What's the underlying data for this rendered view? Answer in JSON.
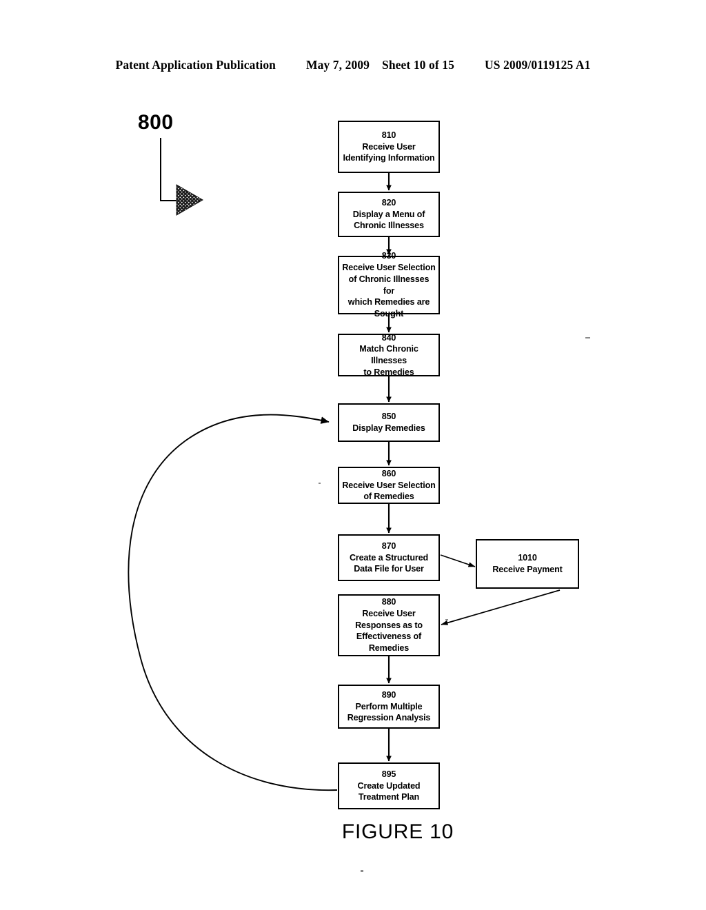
{
  "header": {
    "publication": "Patent Application Publication",
    "date": "May 7, 2009",
    "sheet": "Sheet 10 of 15",
    "patent_number": "US 2009/0119125 A1"
  },
  "figure": {
    "caption": "FIGURE 10",
    "reference_numeral": "800"
  },
  "flowchart": {
    "type": "flowchart",
    "boxes": [
      {
        "id": "810",
        "number": "810",
        "text": "Receive User\nIdentifying Information"
      },
      {
        "id": "820",
        "number": "820",
        "text": "Display a Menu of\nChronic Illnesses"
      },
      {
        "id": "830",
        "number": "830",
        "text": "Receive User Selection\nof Chronic Illnesses for\nwhich Remedies are\nSought"
      },
      {
        "id": "840",
        "number": "840",
        "text": "Match Chronic Illnesses\nto Remedies"
      },
      {
        "id": "850",
        "number": "850",
        "text": "Display Remedies"
      },
      {
        "id": "860",
        "number": "860",
        "text": "Receive User Selection\nof Remedies"
      },
      {
        "id": "870",
        "number": "870",
        "text": "Create a Structured\nData File for User"
      },
      {
        "id": "880",
        "number": "880",
        "text": "Receive User\nResponses as to\nEffectiveness of\nRemedies"
      },
      {
        "id": "890",
        "number": "890",
        "text": "Perform Multiple\nRegression Analysis"
      },
      {
        "id": "895",
        "number": "895",
        "text": "Create Updated\nTreatment Plan"
      },
      {
        "id": "1010",
        "number": "1010",
        "text": "Receive Payment"
      }
    ],
    "connections": [
      {
        "from": "810",
        "to": "820",
        "style": "straight-arrow"
      },
      {
        "from": "820",
        "to": "830",
        "style": "straight-arrow"
      },
      {
        "from": "830",
        "to": "840",
        "style": "straight-arrow"
      },
      {
        "from": "840",
        "to": "850",
        "style": "straight-arrow"
      },
      {
        "from": "850",
        "to": "860",
        "style": "straight-arrow"
      },
      {
        "from": "860",
        "to": "870",
        "style": "straight-arrow"
      },
      {
        "from": "870",
        "to": "1010",
        "style": "diagonal-arrow"
      },
      {
        "from": "1010",
        "to": "880",
        "style": "diagonal-arrow"
      },
      {
        "from": "880",
        "to": "890",
        "style": "straight-arrow"
      },
      {
        "from": "890",
        "to": "895",
        "style": "straight-arrow"
      },
      {
        "from": "895",
        "to": "850",
        "style": "curved-feedback-arrow"
      }
    ]
  },
  "colors": {
    "ink": "#000000",
    "page": "#ffffff"
  }
}
